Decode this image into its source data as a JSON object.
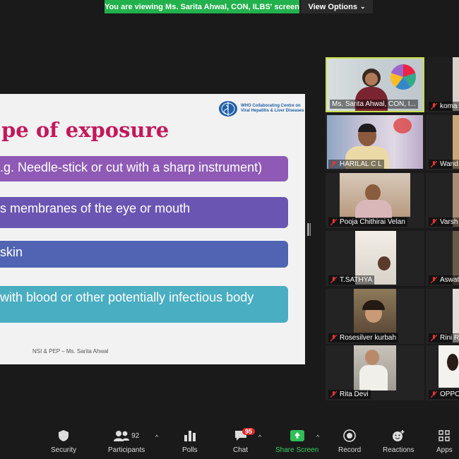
{
  "banner": {
    "text": "You are viewing Ms. Sarita Ahwal, CON, ILBS' screen",
    "color": "#22b14c"
  },
  "view_options": {
    "label": "View Options"
  },
  "slide": {
    "who_text": "WHO Collaborating Centre on Viral Hepatitis & Liver Diseases",
    "title": "pe of exposure",
    "bullets": [
      ".g. Needle-stick or cut with a sharp instrument)",
      "s membranes of the eye or mouth",
      "skin",
      "with blood or other potentially infectious body"
    ],
    "footer": "NSI & PEP – Ms. Sarita Ahwal"
  },
  "participants": [
    {
      "name": "Ms. Sarita Ahwal, CON, I...",
      "active": true
    },
    {
      "name": "koma"
    },
    {
      "name": "HARILAL C L"
    },
    {
      "name": "Wand"
    },
    {
      "name": "Pooja Chithirai Velan"
    },
    {
      "name": "Varsh"
    },
    {
      "name": "T.SATHYA"
    },
    {
      "name": "Aswat"
    },
    {
      "name": "Rosesilver kurbah"
    },
    {
      "name": "Rini R"
    },
    {
      "name": "Rita Devi"
    },
    {
      "name": "OPPO"
    }
  ],
  "toolbar": {
    "security": "Security",
    "participants": "Participants",
    "participants_count": "92",
    "polls": "Polls",
    "chat": "Chat",
    "chat_badge": "95",
    "share_screen": "Share Screen",
    "record": "Record",
    "reactions": "Reactions",
    "apps": "Apps"
  }
}
